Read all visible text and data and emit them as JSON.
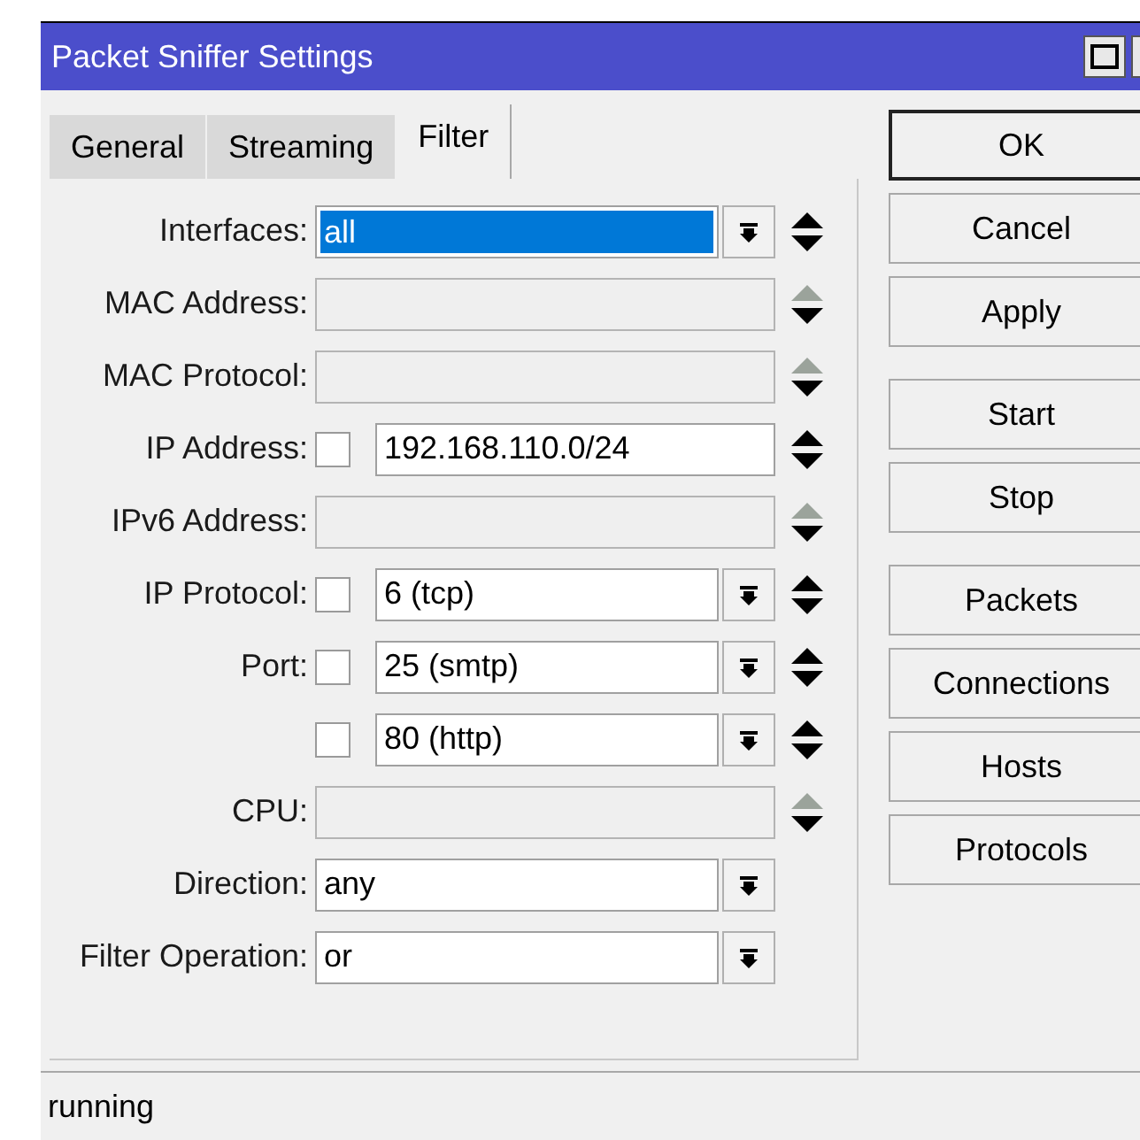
{
  "window": {
    "title": "Packet Sniffer Settings"
  },
  "tabs": [
    {
      "label": "General",
      "selected": false
    },
    {
      "label": "Streaming",
      "selected": false
    },
    {
      "label": "Filter",
      "selected": true
    }
  ],
  "fields": [
    {
      "label": "Interfaces:",
      "value": "all",
      "enabled": true,
      "highlighted": true,
      "dropdown": true,
      "spinner": true
    },
    {
      "label": "MAC Address:",
      "enabled": false,
      "spinner": true
    },
    {
      "label": "MAC Protocol:",
      "enabled": false,
      "spinner": true
    },
    {
      "label": "IP Address:",
      "negated": false,
      "value": "192.168.110.0/24",
      "enabled": true,
      "highlighted": false,
      "dropdown": false,
      "spinner": true
    },
    {
      "label": "IPv6 Address:",
      "enabled": false,
      "spinner": true
    },
    {
      "label": "IP Protocol:",
      "negated": false,
      "value": "6 (tcp)",
      "enabled": true,
      "highlighted": false,
      "dropdown": true,
      "spinner": true
    },
    {
      "label": "Port:",
      "negated": false,
      "value": "25 (smtp)",
      "enabled": true,
      "highlighted": false,
      "dropdown": true,
      "spinner": true
    },
    {
      "negated": false,
      "value": "80 (http)",
      "enabled": true,
      "highlighted": false,
      "dropdown": true,
      "spinner": true
    },
    {
      "label": "CPU:",
      "enabled": false,
      "spinner": true
    },
    {
      "label": "Direction:",
      "value": "any",
      "enabled": true,
      "highlighted": false,
      "dropdown": true,
      "spinner": false
    },
    {
      "label": "Filter Operation:",
      "value": "or",
      "enabled": true,
      "highlighted": false,
      "dropdown": true,
      "spinner": false
    }
  ],
  "button_groups": [
    [
      {
        "label": "OK",
        "default": true
      },
      {
        "label": "Cancel",
        "default": false
      },
      {
        "label": "Apply",
        "default": false
      }
    ],
    [
      {
        "label": "Start",
        "default": false
      },
      {
        "label": "Stop",
        "default": false
      }
    ],
    [
      {
        "label": "Packets",
        "default": false
      },
      {
        "label": "Connections",
        "default": false
      },
      {
        "label": "Hosts",
        "default": false
      },
      {
        "label": "Protocols",
        "default": false
      }
    ]
  ],
  "status_bar": "running"
}
